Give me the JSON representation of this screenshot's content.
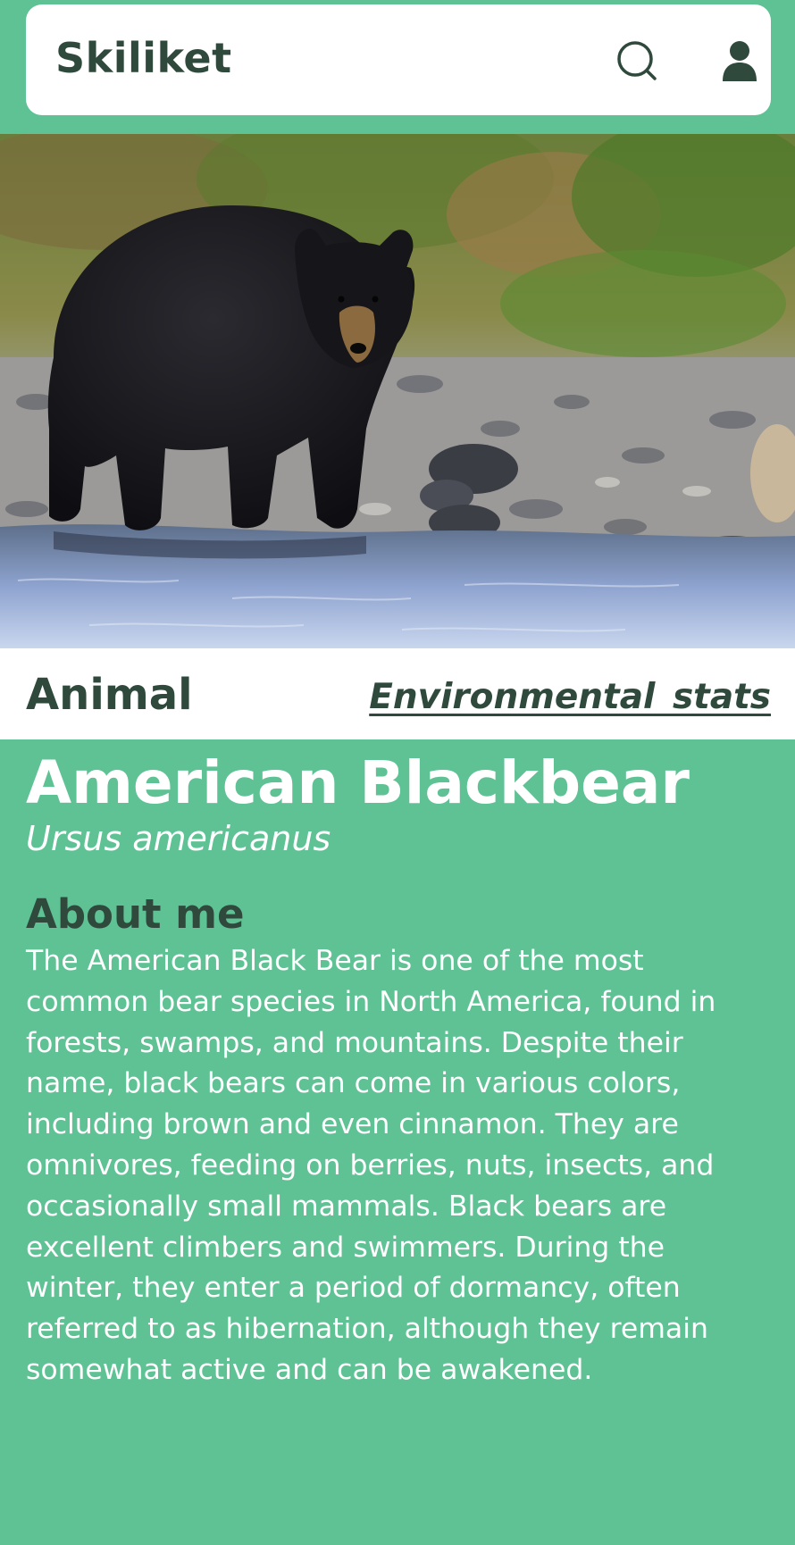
{
  "header": {
    "app_title": "Skiliket",
    "search_icon": "search-icon",
    "user_icon": "user-icon"
  },
  "hero": {
    "image_subject": "black bear standing on river rocks"
  },
  "tabs": {
    "animal_label": "Animal",
    "env_label": "Environmental  stats"
  },
  "species": {
    "common_name": "American Blackbear",
    "scientific_name": "Ursus americanus"
  },
  "about": {
    "heading": "About me",
    "body": "The American Black Bear is one of the most common bear species in North America, found in forests, swamps, and mountains. Despite their name, black bears can come in various colors, including brown and even cinnamon. They are omnivores, feeding on berries, nuts, insects, and occasionally small mammals. Black bears are excellent climbers and swimmers. During the winter, they enter a period of dormancy, often referred to as hibernation, although they remain somewhat active and can be awakened."
  },
  "colors": {
    "background": "#5fc294",
    "dark_text": "#2f4a3d",
    "card": "#ffffff"
  }
}
